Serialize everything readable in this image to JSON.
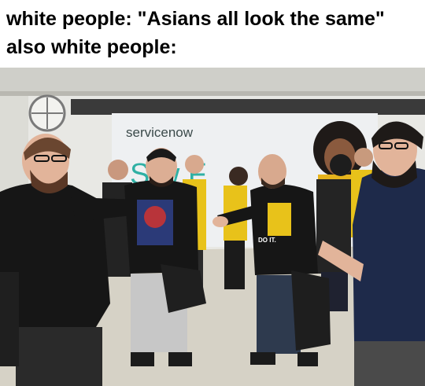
{
  "caption": {
    "line1": "white people: \"Asians all look the same\"",
    "line2": "also white people:"
  },
  "photo": {
    "banner_brand": "servicenow",
    "banner_partial_text": "S  w  F",
    "shirt_print": "DO IT.",
    "colors": {
      "ceiling": "#cfcfc9",
      "wall": "#e8e8e4",
      "banner": "#eef0f2",
      "floor": "#d6d2c6",
      "black_shirt": "#161616",
      "navy_shirt": "#1e2a4a",
      "yellow_shirt": "#e8c21a",
      "jeans": "#2e3a4e",
      "skin": "#e2b49a",
      "beard": "#5a3826"
    }
  }
}
